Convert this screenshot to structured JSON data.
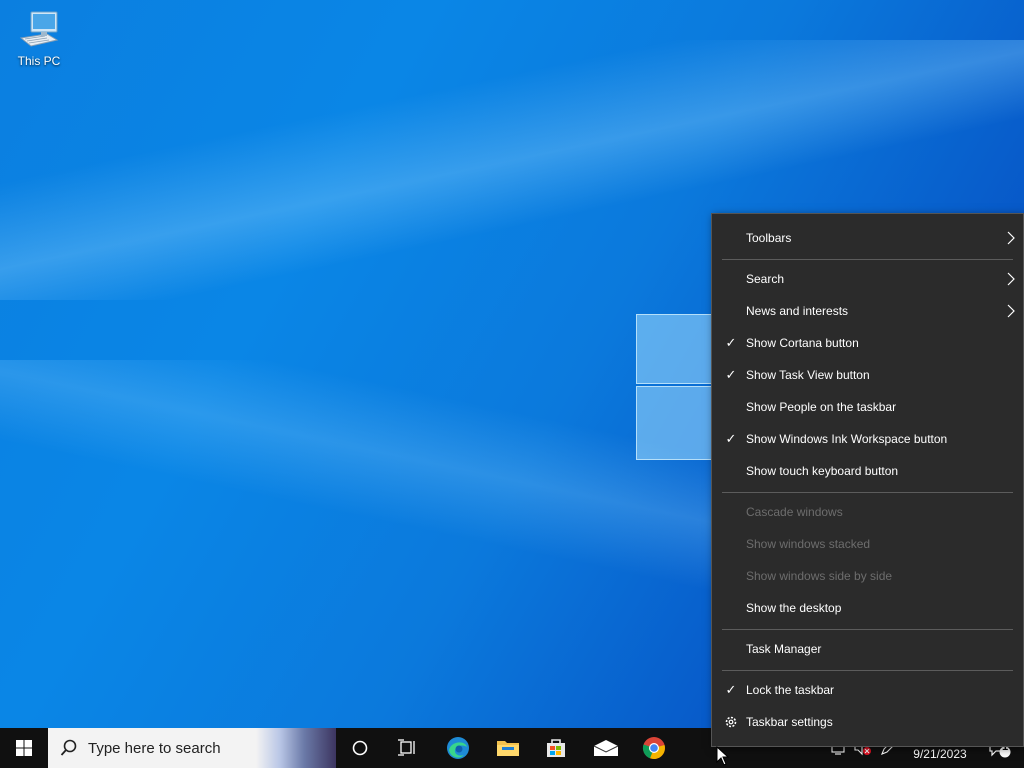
{
  "desktop": {
    "icons": [
      {
        "label": "This PC",
        "icon": "computer-icon"
      }
    ]
  },
  "taskbar": {
    "start_icon": "windows-logo-icon",
    "search_placeholder": "Type here to search",
    "pinned": [
      {
        "name": "cortana",
        "icon": "circle-icon"
      },
      {
        "name": "task-view",
        "icon": "task-view-icon"
      },
      {
        "name": "edge",
        "icon": "edge-icon"
      },
      {
        "name": "file-explorer",
        "icon": "folder-icon"
      },
      {
        "name": "microsoft-store",
        "icon": "store-icon"
      },
      {
        "name": "mail",
        "icon": "mail-icon"
      },
      {
        "name": "chrome",
        "icon": "chrome-icon"
      }
    ],
    "clock_date": "9/21/2023",
    "notification_count": "1"
  },
  "context_menu": {
    "items": [
      {
        "label": "Toolbars",
        "checked": false,
        "submenu": true,
        "enabled": true
      },
      {
        "label": "Search",
        "checked": false,
        "submenu": true,
        "enabled": true
      },
      {
        "label": "News and interests",
        "checked": false,
        "submenu": true,
        "enabled": true
      },
      {
        "label": "Show Cortana button",
        "checked": true,
        "submenu": false,
        "enabled": true
      },
      {
        "label": "Show Task View button",
        "checked": true,
        "submenu": false,
        "enabled": true
      },
      {
        "label": "Show People on the taskbar",
        "checked": false,
        "submenu": false,
        "enabled": true
      },
      {
        "label": "Show Windows Ink Workspace button",
        "checked": true,
        "submenu": false,
        "enabled": true
      },
      {
        "label": "Show touch keyboard button",
        "checked": false,
        "submenu": false,
        "enabled": true
      },
      {
        "label": "Cascade windows",
        "checked": false,
        "submenu": false,
        "enabled": false
      },
      {
        "label": "Show windows stacked",
        "checked": false,
        "submenu": false,
        "enabled": false
      },
      {
        "label": "Show windows side by side",
        "checked": false,
        "submenu": false,
        "enabled": false
      },
      {
        "label": "Show the desktop",
        "checked": false,
        "submenu": false,
        "enabled": true
      },
      {
        "label": "Task Manager",
        "checked": false,
        "submenu": false,
        "enabled": true
      },
      {
        "label": "Lock the taskbar",
        "checked": true,
        "submenu": false,
        "enabled": true
      },
      {
        "label": "Taskbar settings",
        "checked": false,
        "submenu": false,
        "enabled": true,
        "icon": "gear-icon"
      }
    ],
    "check_glyph": "✓"
  }
}
